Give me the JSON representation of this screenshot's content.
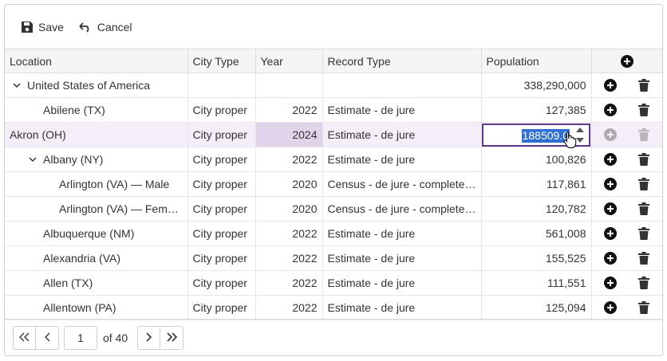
{
  "toolbar": {
    "save_label": "Save",
    "cancel_label": "Cancel"
  },
  "columns": {
    "location": "Location",
    "city_type": "City Type",
    "year": "Year",
    "record_type": "Record Type",
    "population": "Population"
  },
  "rows": [
    {
      "location": "United States of America",
      "city_type": "",
      "year": "",
      "record_type": "",
      "population": "338,290,000"
    },
    {
      "location": "Abilene (TX)",
      "city_type": "City proper",
      "year": "2022",
      "record_type": "Estimate - de jure",
      "population": "127,385"
    },
    {
      "location": "Akron (OH)",
      "city_type": "City proper",
      "year": "2024",
      "record_type": "Estimate - de jure",
      "population": "188509.0"
    },
    {
      "location": "Albany (NY)",
      "city_type": "City proper",
      "year": "2022",
      "record_type": "Estimate - de jure",
      "population": "100,826"
    },
    {
      "location": "Arlington (VA) — Male",
      "city_type": "City proper",
      "year": "2020",
      "record_type": "Census - de jure - complete…",
      "population": "117,861"
    },
    {
      "location": "Arlington (VA) — Female",
      "city_type": "City proper",
      "year": "2020",
      "record_type": "Census - de jure - complete…",
      "population": "120,782"
    },
    {
      "location": "Albuquerque (NM)",
      "city_type": "City proper",
      "year": "2022",
      "record_type": "Estimate - de jure",
      "population": "561,008"
    },
    {
      "location": "Alexandria (VA)",
      "city_type": "City proper",
      "year": "2022",
      "record_type": "Estimate - de jure",
      "population": "155,525"
    },
    {
      "location": "Allen (TX)",
      "city_type": "City proper",
      "year": "2022",
      "record_type": "Estimate - de jure",
      "population": "111,551"
    },
    {
      "location": "Allentown (PA)",
      "city_type": "City proper",
      "year": "2022",
      "record_type": "Estimate - de jure",
      "population": "125,094"
    }
  ],
  "pager": {
    "page": "1",
    "of_label": "of 40"
  },
  "colors": {
    "accent": "#5f3a8a",
    "selection": "#2f6fd1",
    "editing_row": "#f3eef7",
    "editing_cell": "#e0d4ea"
  },
  "icons": [
    "save-icon",
    "undo-icon",
    "add-icon",
    "delete-icon",
    "chevron-down-icon",
    "first-page-icon",
    "prev-page-icon",
    "next-page-icon",
    "last-page-icon"
  ]
}
